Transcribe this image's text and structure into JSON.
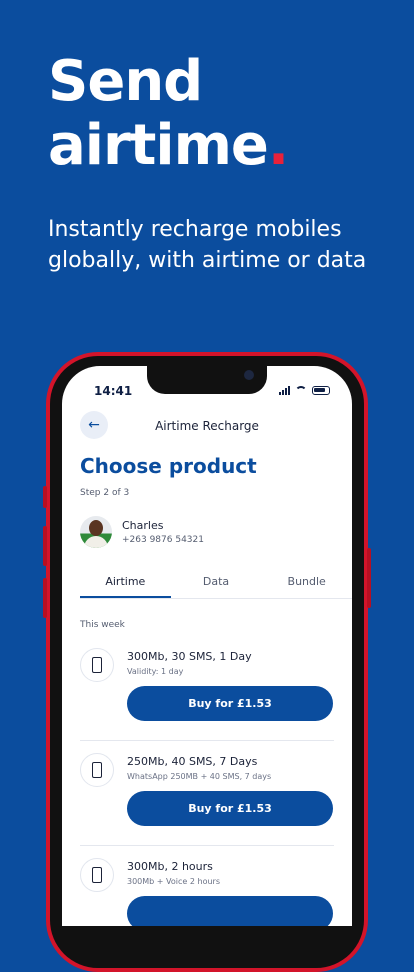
{
  "hero": {
    "title_line1": "Send",
    "title_line2": "airtime",
    "title_dot": ".",
    "subtitle": "Instantly recharge mobiles globally, with airtime or data"
  },
  "status_bar": {
    "time": "14:41"
  },
  "screen": {
    "header_title": "Airtime Recharge",
    "heading": "Choose product",
    "step": "Step 2 of 3"
  },
  "contact": {
    "name": "Charles",
    "phone": "+263 9876 54321"
  },
  "tabs": [
    {
      "label": "Airtime",
      "active": true
    },
    {
      "label": "Data",
      "active": false
    },
    {
      "label": "Bundle",
      "active": false
    }
  ],
  "section_label": "This week",
  "products": [
    {
      "title": "300Mb, 30 SMS, 1 Day",
      "description": "Validity: 1 day",
      "button": "Buy for £1.53"
    },
    {
      "title": "250Mb, 40 SMS, 7 Days",
      "description": "WhatsApp 250MB + 40 SMS, 7 days",
      "button": "Buy for £1.53"
    },
    {
      "title": "300Mb, 2 hours",
      "description": "300Mb + Voice 2 hours",
      "button": ""
    }
  ],
  "colors": {
    "brand_blue": "#0b4d9e",
    "accent_red": "#e8213a",
    "phone_red": "#d3142a"
  },
  "icons": [
    "back-arrow-icon",
    "signal-icon",
    "wifi-icon",
    "battery-icon",
    "mobile-phone-icon"
  ]
}
